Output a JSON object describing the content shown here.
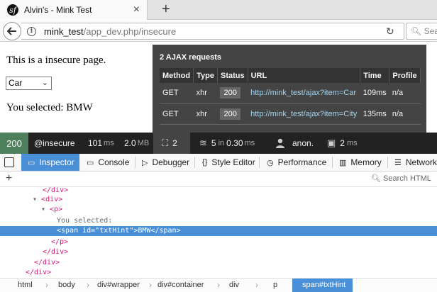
{
  "browser": {
    "tab_title": "Alvin's - Mink Test",
    "tab_close": "×",
    "new_tab": "+",
    "url_host": "mink_test",
    "url_path": "/app_dev.php/insecure",
    "search_placeholder": "Sea",
    "favicon_glyph": "sf"
  },
  "page": {
    "heading": "This is a insecure page.",
    "select_value": "Car",
    "selected_text": "You selected: BMW"
  },
  "ajax": {
    "title": "2 AJAX requests",
    "columns": [
      "Method",
      "Type",
      "Status",
      "URL",
      "Time",
      "Profile"
    ],
    "rows": [
      {
        "method": "GET",
        "type": "xhr",
        "status": "200",
        "url": "http://mink_test/ajax?item=Car",
        "time": "109ms",
        "profile": "n/a"
      },
      {
        "method": "GET",
        "type": "xhr",
        "status": "200",
        "url": "http://mink_test/ajax?item=City",
        "time": "135ms",
        "profile": "n/a"
      }
    ]
  },
  "toolbar": {
    "status_code": "200",
    "route": "@insecure",
    "time_value": "101",
    "time_unit": "ms",
    "memory_value": "2.0",
    "memory_unit": "MB",
    "ajax_count": "2",
    "queries_value": "5",
    "queries_suffix": "in",
    "queries_time": "0.30",
    "queries_unit": "ms",
    "user": "anon.",
    "render_value": "2",
    "render_unit": "ms",
    "status_color": "#4f805d"
  },
  "devtools": {
    "tabs": [
      "Inspector",
      "Console",
      "Debugger",
      "Style Editor",
      "Performance",
      "Memory",
      "Network"
    ],
    "search_placeholder": "Search HTML",
    "add_node": "+",
    "markup_lines": [
      "</div>",
      "<div>",
      "<p>",
      "You selected:",
      "<span id=\"txtHint\">BMW</span>",
      "</p>",
      "</div>",
      "</div>",
      "</div>"
    ],
    "breadcrumbs": [
      "html",
      "body",
      "div#wrapper",
      "div#container",
      "div",
      "p",
      "span#txtHint"
    ],
    "accent_color": "#4a90d9"
  }
}
